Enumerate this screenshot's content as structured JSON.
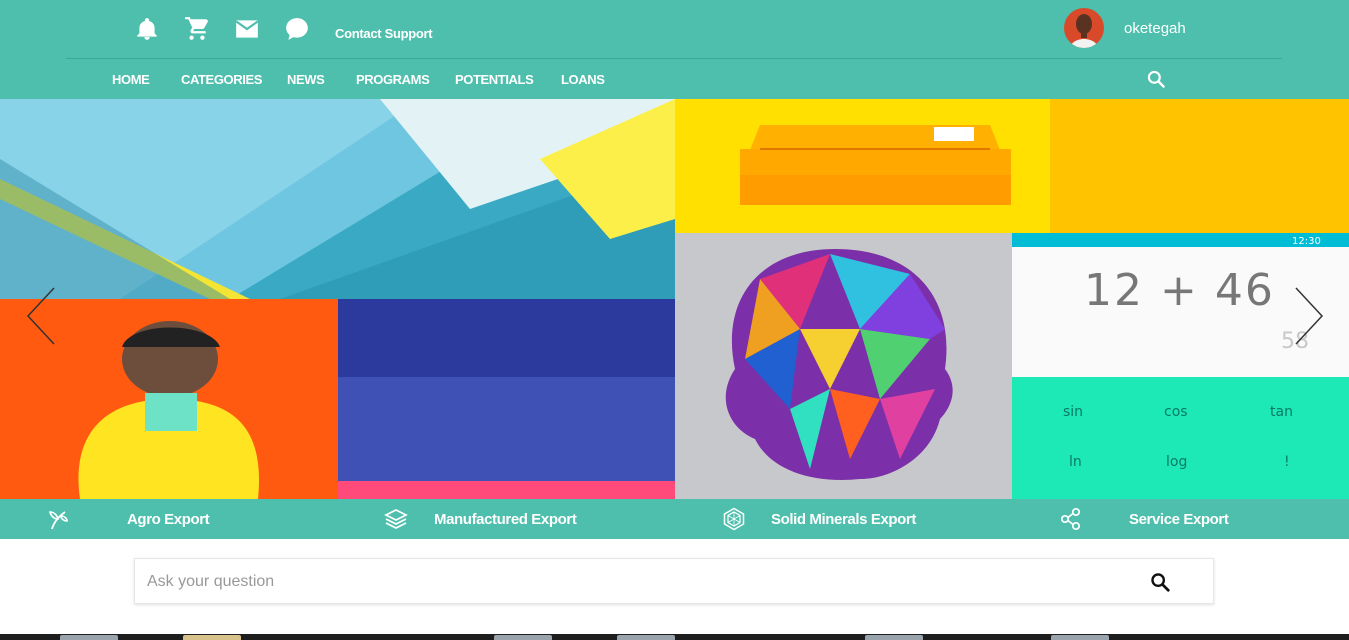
{
  "colors": {
    "brand": "#4dbfac",
    "white": "#ffffff",
    "muted": "#999999"
  },
  "topbar": {
    "icons": [
      "bell-icon",
      "cart-icon",
      "mail-icon",
      "chat-icon"
    ],
    "contact_label": "Contact Support",
    "username": "oketegah"
  },
  "nav": {
    "items": [
      "HOME",
      "CATEGORIES",
      "NEWS",
      "PROGRAMS",
      "POTENTIALS",
      "LOANS"
    ],
    "search_icon": "search-icon"
  },
  "carousel": {
    "calculator": {
      "status_time": "12:30",
      "expression": "12 + 46",
      "result": "58",
      "keys": [
        "sin",
        "cos",
        "tan",
        "ln",
        "log",
        "!"
      ]
    },
    "prev_icon": "chevron-left-icon",
    "next_icon": "chevron-right-icon"
  },
  "categories": [
    {
      "label": "Agro Export",
      "icon": "sprout-icon"
    },
    {
      "label": "Manufactured Export",
      "icon": "layers-icon"
    },
    {
      "label": "Solid Minerals Export",
      "icon": "mineral-icon"
    },
    {
      "label": "Service Export",
      "icon": "share-nodes-icon"
    }
  ],
  "search": {
    "placeholder": "Ask your question",
    "value": ""
  }
}
